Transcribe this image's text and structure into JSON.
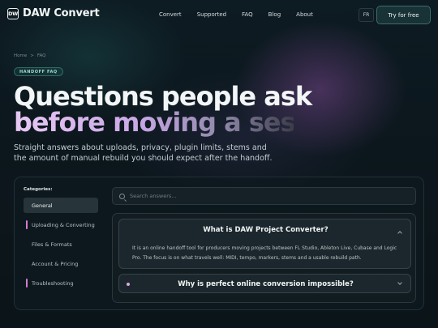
{
  "brand": {
    "mark": "DW",
    "name": "DAW Convert"
  },
  "nav": {
    "links": [
      "Convert",
      "Supported",
      "FAQ",
      "Blog",
      "About"
    ],
    "lang": "FR",
    "cta": "Try for free"
  },
  "breadcrumb": [
    "Home",
    ">",
    "FAQ"
  ],
  "hero": {
    "badge": "HANDOFF FAQ",
    "title_line1": "Questions people ask",
    "title_line2": "before moving a session",
    "subtitle": "Straight answers about uploads, privacy, plugin limits, stems and the amount of manual rebuild you should expect after the handoff."
  },
  "faq": {
    "categories_label": "Categories:",
    "categories": [
      "General",
      "Uploading & Converting",
      "Files & Formats",
      "Account & Pricing",
      "Troubleshooting"
    ],
    "active_category": "General",
    "search_placeholder": "Search answers...",
    "items": [
      {
        "question": "What is DAW Project Converter?",
        "answer": "It is an online handoff tool for producers moving projects between FL Studio, Ableton Live, Cubase and Logic Pro. The focus is on what travels well: MIDI, tempo, markers, stems and a usable rebuild path.",
        "open": true
      },
      {
        "question": "Why is perfect online conversion impossible?",
        "open": false
      }
    ]
  },
  "colors": {
    "accent_teal": "#3a6f6b",
    "accent_pink": "#d77ad2",
    "background": "#0c171d"
  }
}
